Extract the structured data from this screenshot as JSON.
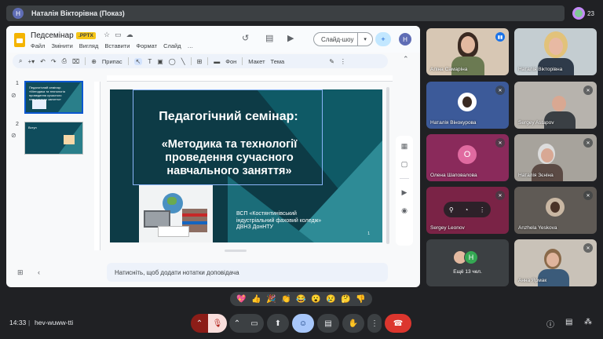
{
  "presenter": {
    "avatar_letter": "Н",
    "name": "Наталія Вікторівна (Показ)"
  },
  "participants_count": "23",
  "slides_app": {
    "doc_title": "Педсемінар",
    "file_badge": ".PPTX",
    "menu": [
      "Файл",
      "Змінити",
      "Вигляд",
      "Вставити",
      "Формат",
      "Слайд",
      "…"
    ],
    "slideshow_label": "Слайд-шоу",
    "user_avatar_letter": "Н",
    "toolbar": {
      "fit_label": "Припас",
      "background_label": "Фон",
      "layout_label": "Макет",
      "theme_label": "Тема"
    },
    "thumbnails": [
      {
        "number": "1",
        "text": "Педагогічний семінар: «Методика та технологія проведення сучасного навчального заняття»"
      },
      {
        "number": "2",
        "text": "Вступ"
      }
    ],
    "slide": {
      "heading": "Педагогічний семінар:",
      "subtitle": "«Методика та технології\nпроведення сучасного\nнавчального заняття»",
      "footer": "ВСП «Костянтинівський\nіндустріальний фаховий коледж»\nДВНЗ ДонНТУ",
      "page_number": "1"
    },
    "notes_placeholder": "Натисніть, щоб додати нотатки доповідача"
  },
  "tiles": [
    {
      "name": "Аліна Самаріна",
      "state": "speaking"
    },
    {
      "name": "Наталія Вікторівна",
      "state": "none"
    },
    {
      "name": "Наталія Вінокурова",
      "state": "muted"
    },
    {
      "name": "Sergey Astapov",
      "state": "muted"
    },
    {
      "name": "Олена Шаповалова",
      "avatar_letter": "О",
      "state": "muted"
    },
    {
      "name": "Наталія Зєніна",
      "state": "muted"
    },
    {
      "name": "Sergey Leonov",
      "state": "muted"
    },
    {
      "name": "Anzhela Yeskova",
      "state": "muted"
    },
    {
      "name": "Ещё 13 чел.",
      "avatar_letter": "Н"
    },
    {
      "name": "Анна Ярмак",
      "state": "muted"
    }
  ],
  "reactions": [
    "💖",
    "👍",
    "🎉",
    "👏",
    "😂",
    "😮",
    "😢",
    "🤔",
    "👎"
  ],
  "bottom": {
    "time": "14:33",
    "separator": "|",
    "meeting_code": "hev-wuww-tti"
  },
  "colors": {
    "accent": "#1a73e8",
    "end_call": "#dc362e",
    "slide_bg": "#0d3b46"
  }
}
